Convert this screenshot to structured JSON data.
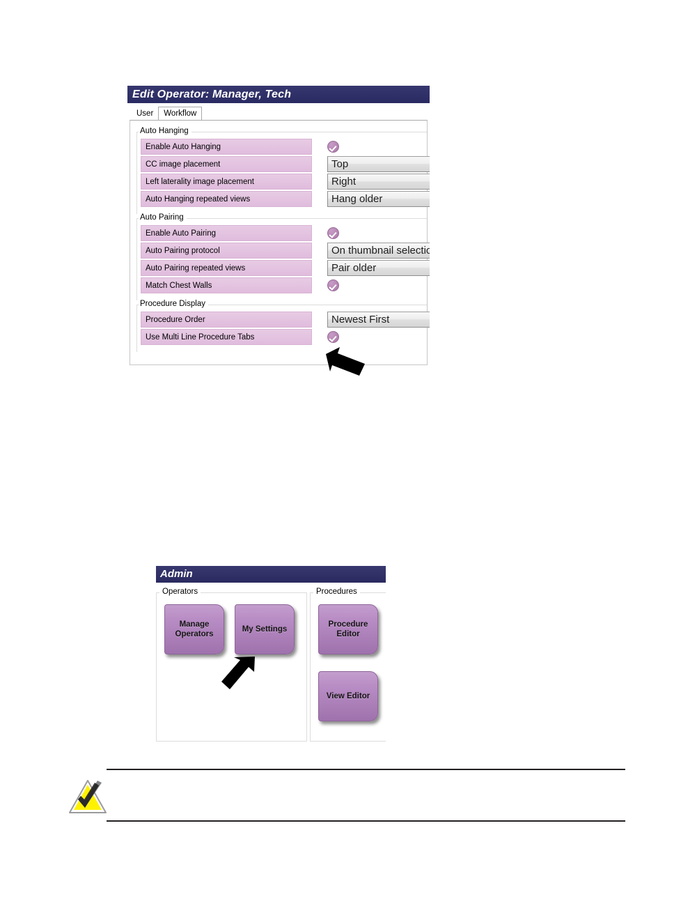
{
  "page": {
    "background": "#ffffff",
    "accent_purple": "#a377b0",
    "title_bar_color": "#2e2e6e",
    "row_label_color": "#e2bfdf"
  },
  "edit_operator_dialog": {
    "title": "Edit Operator: Manager, Tech",
    "tabs": [
      {
        "label": "User",
        "active": false
      },
      {
        "label": "Workflow",
        "active": true
      }
    ],
    "groups": [
      {
        "title": "Auto Hanging",
        "rows": [
          {
            "label": "Enable Auto Hanging",
            "control": "checkbox",
            "checked": true
          },
          {
            "label": "CC image placement",
            "control": "combo",
            "value": "Top"
          },
          {
            "label": "Left laterality image placement",
            "control": "combo",
            "value": "Right"
          },
          {
            "label": "Auto Hanging repeated views",
            "control": "combo",
            "value": "Hang older"
          }
        ]
      },
      {
        "title": "Auto Pairing",
        "rows": [
          {
            "label": "Enable Auto Pairing",
            "control": "checkbox",
            "checked": true
          },
          {
            "label": "Auto Pairing protocol",
            "control": "combo",
            "value": "On thumbnail selection"
          },
          {
            "label": "Auto Pairing repeated views",
            "control": "combo",
            "value": "Pair older"
          },
          {
            "label": "Match Chest Walls",
            "control": "checkbox",
            "checked": true
          }
        ]
      },
      {
        "title": "Procedure Display",
        "rows": [
          {
            "label": "Procedure Order",
            "control": "combo",
            "value": "Newest First"
          },
          {
            "label": "Use Multi Line Procedure Tabs",
            "control": "checkbox",
            "checked": true
          }
        ]
      }
    ],
    "callout_arrow": "arrow-pointing-to-use-multi-line-procedure-tabs-checkbox"
  },
  "admin_screen": {
    "title": "Admin",
    "groups": [
      {
        "title": "Operators",
        "tiles": [
          {
            "label_line1": "Manage",
            "label_line2": "Operators"
          },
          {
            "label_line1": "My Settings",
            "label_line2": ""
          }
        ]
      },
      {
        "title": "Procedures",
        "tiles": [
          {
            "label_line1": "Procedure",
            "label_line2": "Editor"
          },
          {
            "label_line1": "View Editor",
            "label_line2": ""
          }
        ]
      }
    ],
    "callout_arrow": "arrow-pointing-to-my-settings-button"
  },
  "note_callout": {
    "icon": "note-triangle-check-icon",
    "text": ""
  }
}
